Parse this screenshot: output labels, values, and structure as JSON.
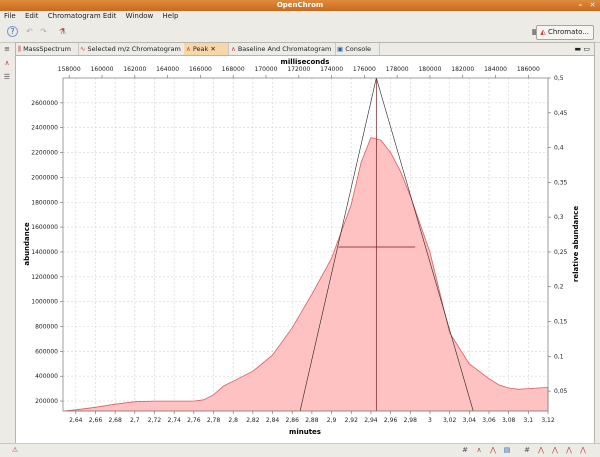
{
  "window": {
    "title": "OpenChrom"
  },
  "menu": [
    "File",
    "Edit",
    "Chromatogram Edit",
    "Window",
    "Help"
  ],
  "toolbar": {
    "perspective_label": "Chromato..."
  },
  "tabs": [
    {
      "label": "MassSpectrum",
      "active": false
    },
    {
      "label": "Selected m/z Chromatogram",
      "active": false
    },
    {
      "label": "Peak",
      "active": true
    },
    {
      "label": "Baseline And Chromatogram",
      "active": false
    },
    {
      "label": "Console",
      "active": false
    }
  ],
  "chart_data": {
    "type": "area",
    "xlabel": "minutes",
    "x2label": "milliseconds",
    "ylabel": "abundance",
    "y2label": "relative abundance",
    "xlim": [
      2.627,
      3.12
    ],
    "ylim": [
      120000,
      2800000
    ],
    "x_ticks": [
      "2,64",
      "2,66",
      "2,68",
      "2,7",
      "2,72",
      "2,74",
      "2,76",
      "2,78",
      "2,8",
      "2,82",
      "2,84",
      "2,86",
      "2,88",
      "2,9",
      "2,92",
      "2,94",
      "2,96",
      "2,98",
      "3",
      "3,02",
      "3,04",
      "3,06",
      "3,08",
      "3,1",
      "3,12"
    ],
    "x2_ticks": [
      "158000",
      "160000",
      "162000",
      "164000",
      "166000",
      "168000",
      "170000",
      "172000",
      "174000",
      "176000",
      "178000",
      "180000",
      "182000",
      "184000",
      "186000"
    ],
    "y_ticks": [
      "200000",
      "400000",
      "600000",
      "800000",
      "1000000",
      "1200000",
      "1400000",
      "1600000",
      "1800000",
      "2000000",
      "2200000",
      "2400000",
      "2600000"
    ],
    "y2_ticks": [
      "0,05",
      "0,1",
      "0,15",
      "0,2",
      "0,25",
      "0,3",
      "0,35",
      "0,4",
      "0,45",
      "0,5"
    ],
    "series": [
      {
        "fill": "#ffc2c2",
        "stroke": "#e05c5c",
        "x": [
          2.627,
          2.64,
          2.66,
          2.68,
          2.7,
          2.72,
          2.74,
          2.76,
          2.77,
          2.78,
          2.79,
          2.8,
          2.82,
          2.84,
          2.86,
          2.88,
          2.9,
          2.92,
          2.93,
          2.94,
          2.95,
          2.96,
          2.97,
          2.98,
          3.0,
          3.02,
          3.04,
          3.06,
          3.07,
          3.08,
          3.09,
          3.1,
          3.12
        ],
        "y": [
          120000,
          130000,
          150000,
          175000,
          195000,
          200000,
          200000,
          200000,
          210000,
          250000,
          320000,
          360000,
          440000,
          570000,
          790000,
          1060000,
          1350000,
          1780000,
          2120000,
          2320000,
          2300000,
          2200000,
          2050000,
          1850000,
          1400000,
          750000,
          500000,
          380000,
          330000,
          305000,
          295000,
          300000,
          310000
        ]
      }
    ],
    "peak_model": {
      "apex_x": 2.9455,
      "apex_y": 2800000,
      "left_base_x": 2.868,
      "right_base_x": 3.044,
      "half_height_y": 1440000,
      "half_left_x": 2.907,
      "half_right_x": 2.985
    }
  },
  "status_icons": [
    "error-icon",
    "peak-icon",
    "chart-icon",
    "chart-icon",
    "chart-icon",
    "chart-icon",
    "chart-icon",
    "chart-icon"
  ],
  "colors": {
    "accent": "#d77a2e",
    "grid": "#cfcfcf"
  }
}
